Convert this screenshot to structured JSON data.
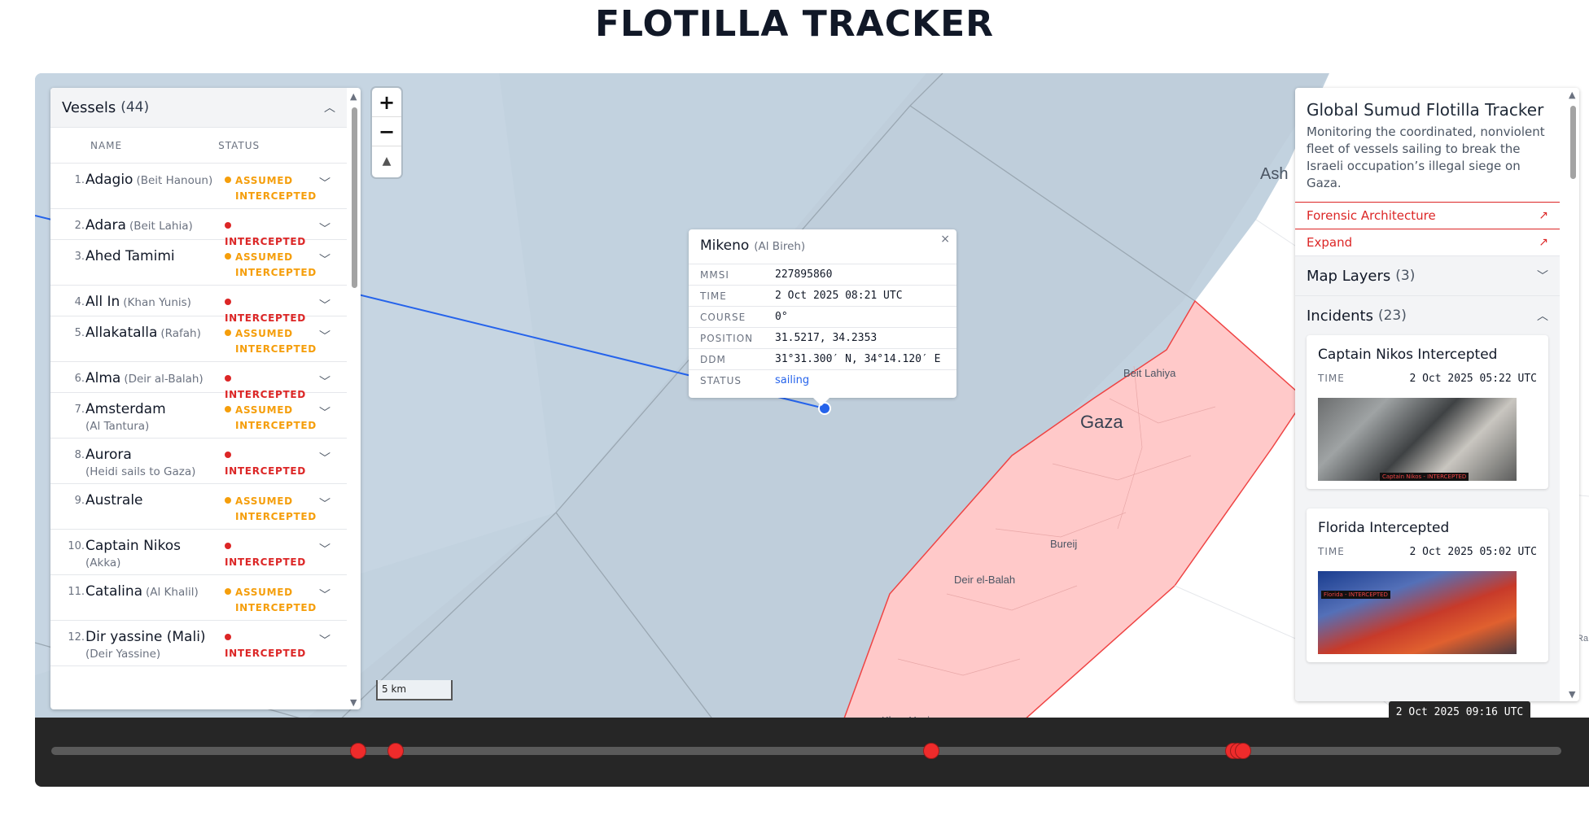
{
  "page": {
    "title": "FLOTILLA TRACKER"
  },
  "vessels": {
    "title": "Vessels",
    "count": "(44)",
    "col_name": "NAME",
    "col_status": "STATUS",
    "items": [
      {
        "num": "1.",
        "name": "Adagio",
        "sub": "(Beit Hanoun)",
        "status": "assumed",
        "status_l1": "ASSUMED",
        "status_l2": "INTERCEPTED"
      },
      {
        "num": "2.",
        "name": "Adara",
        "sub": "(Beit Lahia)",
        "status": "intercepted",
        "status_l1": "INTERCEPTED"
      },
      {
        "num": "3.",
        "name": "Ahed Tamimi",
        "sub": "",
        "status": "assumed",
        "status_l1": "ASSUMED",
        "status_l2": "INTERCEPTED"
      },
      {
        "num": "4.",
        "name": "All In",
        "sub": "(Khan Yunis)",
        "status": "intercepted",
        "status_l1": "INTERCEPTED"
      },
      {
        "num": "5.",
        "name": "Allakatalla",
        "sub": "(Rafah)",
        "status": "assumed",
        "status_l1": "ASSUMED",
        "status_l2": "INTERCEPTED"
      },
      {
        "num": "6.",
        "name": "Alma",
        "sub": "(Deir al-Balah)",
        "status": "intercepted",
        "status_l1": "INTERCEPTED"
      },
      {
        "num": "7.",
        "name": "Amsterdam",
        "sub": "(Al Tantura)",
        "sub_block": true,
        "status": "assumed",
        "status_l1": "ASSUMED",
        "status_l2": "INTERCEPTED"
      },
      {
        "num": "8.",
        "name": "Aurora",
        "sub": "(Heidi sails to Gaza)",
        "sub_block": true,
        "status": "intercepted",
        "status_l1": "INTERCEPTED"
      },
      {
        "num": "9.",
        "name": "Australe",
        "sub": "",
        "status": "assumed",
        "status_l1": "ASSUMED",
        "status_l2": "INTERCEPTED"
      },
      {
        "num": "10.",
        "name": "Captain Nikos",
        "sub": "(Akka)",
        "sub_block": true,
        "status": "intercepted",
        "status_l1": "INTERCEPTED"
      },
      {
        "num": "11.",
        "name": "Catalina",
        "sub": "(Al Khalil)",
        "status": "assumed",
        "status_l1": "ASSUMED",
        "status_l2": "INTERCEPTED"
      },
      {
        "num": "12.",
        "name": "Dir yassine (Mali)",
        "sub": "(Deir Yassine)",
        "sub_block": true,
        "status": "intercepted",
        "status_l1": "INTERCEPTED"
      }
    ]
  },
  "map": {
    "zoom_in": "+",
    "zoom_out": "−",
    "compass": "▲",
    "scale_label": "5 km",
    "labels": {
      "gaza": "Gaza",
      "beit_lahiya": "Beit Lahiya",
      "bureij": "Bureij",
      "deir_el_balah": "Deir el-Balah",
      "ash": "Ash",
      "khan_yunis": "Khan Yunis",
      "ra": "Ra"
    },
    "colors": {
      "sea": "#c2d2df",
      "land": "#ffffff",
      "gaza_fill": "#ffc9c9",
      "gaza_stroke": "#ef4444",
      "track": "#2563eb"
    }
  },
  "popup": {
    "name": "Mikeno",
    "sub": "(Al Bireh)",
    "close": "×",
    "rows": [
      {
        "k": "MMSI",
        "v": "227895860"
      },
      {
        "k": "TIME",
        "v": "2 Oct 2025 08:21 UTC"
      },
      {
        "k": "COURSE",
        "v": "0°"
      },
      {
        "k": "POSITION",
        "v": "31.5217, 34.2353"
      },
      {
        "k": "DDM",
        "v": "31°31.300′ N, 34°14.120′ E"
      },
      {
        "k": "STATUS",
        "v": "sailing"
      }
    ]
  },
  "info": {
    "title": "Global Sumud Flotilla Tracker",
    "desc": "Monitoring the coordinated, nonviolent fleet of vessels sailing to break the Israeli occupation’s illegal siege on Gaza.",
    "link1": "Forensic Architecture",
    "link2": "Expand",
    "layers_title": "Map Layers",
    "layers_count": "(3)",
    "incidents_title": "Incidents",
    "incidents_count": "(23)",
    "incidents": [
      {
        "title": "Captain Nikos Intercepted",
        "time_label": "TIME",
        "time": "2 Oct 2025 05:22 UTC",
        "photo_tag": "Captain Nikos - INTERCEPTED"
      },
      {
        "title": "Florida Intercepted",
        "time_label": "TIME",
        "time": "2 Oct 2025 05:02 UTC",
        "photo_tag": "Florida - INTERCEPTED"
      }
    ]
  },
  "timeline": {
    "current": "2 Oct 2025 09:16 UTC",
    "marker_positions": [
      0.203,
      0.228,
      0.583,
      0.783,
      0.786,
      0.789
    ],
    "colors": {
      "marker": "#ef2b2b",
      "track": "#5a5a5a"
    }
  }
}
